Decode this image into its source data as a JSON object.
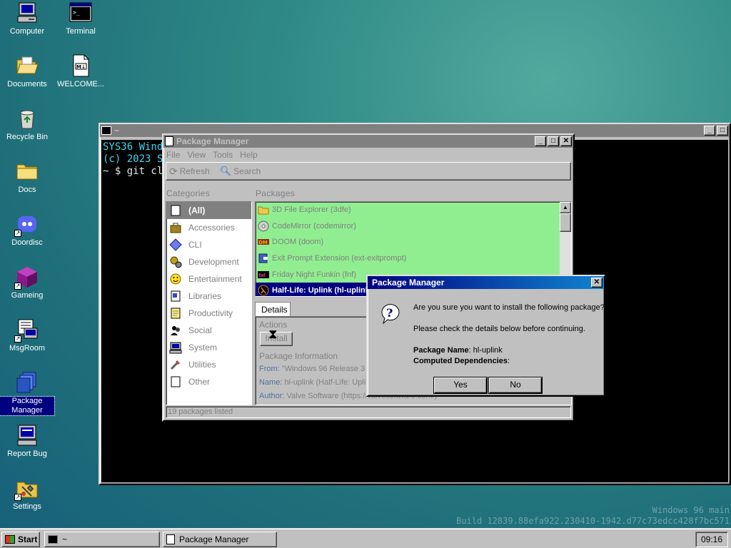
{
  "desktop": {
    "icons": [
      {
        "label": "Computer"
      },
      {
        "label": "Terminal"
      },
      {
        "label": "Documents"
      },
      {
        "label": "WELCOME..."
      },
      {
        "label": "Recycle Bin"
      },
      {
        "label": "Docs"
      },
      {
        "label": "Doordisc"
      },
      {
        "label": "Gameing"
      },
      {
        "label": "MsgRoom"
      },
      {
        "label": "Package Manager"
      },
      {
        "label": "Report Bug"
      },
      {
        "label": "Settings"
      }
    ],
    "selected_icon": "Package Manager"
  },
  "terminal": {
    "title": "~",
    "lines": [
      "SYS36 Windo",
      "(c) 2023 Sy",
      "",
      "~ $ git clo"
    ]
  },
  "package_manager": {
    "title": "Package Manager",
    "menu": [
      "File",
      "View",
      "Tools",
      "Help"
    ],
    "toolbar": {
      "refresh": "Refresh",
      "search": "Search"
    },
    "categories_header": "Categories",
    "packages_header": "Packages",
    "categories": [
      {
        "label": "(All)",
        "icon": "all-icon",
        "selected": true
      },
      {
        "label": "Accessories",
        "icon": "briefcase-icon"
      },
      {
        "label": "CLI",
        "icon": "diamond-icon"
      },
      {
        "label": "Development",
        "icon": "gears-icon"
      },
      {
        "label": "Entertainment",
        "icon": "smiley-icon"
      },
      {
        "label": "Libraries",
        "icon": "book-icon"
      },
      {
        "label": "Productivity",
        "icon": "notepad-icon"
      },
      {
        "label": "Social",
        "icon": "people-icon"
      },
      {
        "label": "System",
        "icon": "computer-icon"
      },
      {
        "label": "Utilities",
        "icon": "tools-icon"
      },
      {
        "label": "Other",
        "icon": "blank-icon"
      }
    ],
    "packages": [
      {
        "label": "3D File Explorer (3dfe)",
        "icon": "folder-icon"
      },
      {
        "label": "CodeMirror (codemirror)",
        "icon": "cd-icon"
      },
      {
        "label": "DOOM (doom)",
        "icon": "doom-icon"
      },
      {
        "label": "Exit Prompt Extension (ext-exitprompt)",
        "icon": "exit-icon"
      },
      {
        "label": "Friday Night Funkin (fnf)",
        "icon": "fnf-icon"
      },
      {
        "label": "Half-Life: Uplink (hl-uplink)",
        "icon": "halflife-icon",
        "selected": true
      }
    ],
    "details_tab": "Details",
    "actions_label": "Actions",
    "install_button": "Install",
    "package_info_header": "Package Information",
    "info": [
      {
        "key": "From:",
        "value": "\"Windows 96 Release 3 (..."
      },
      {
        "key": "Name:",
        "value": "hl-uplink (Half-Life: Uplink..."
      },
      {
        "key": "Author:",
        "value": "Valve Software (https://valvesoftware.com/)"
      }
    ],
    "status": "19 packages listed"
  },
  "dialog": {
    "title": "Package Manager",
    "question": "Are you sure you want to install the following package?",
    "hint": "Please check the details below before continuing.",
    "package_name_label": "Package Name",
    "package_name_value": ": hl-uplink",
    "deps_label": "Computed Dependencies",
    "deps_value": ":",
    "yes": "Yes",
    "no": "No"
  },
  "taskbar": {
    "start": "Start",
    "items": [
      "~",
      "Package Manager"
    ],
    "clock": "09:16"
  },
  "watermark": {
    "line1": "Windows 96 main",
    "line2": "Build 12839.88efa922.230410-1942.d77c73edcc428f7bc571"
  }
}
